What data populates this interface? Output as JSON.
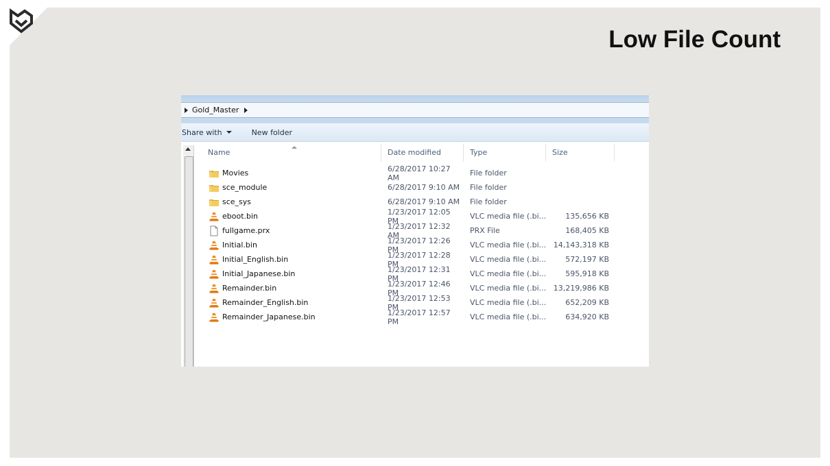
{
  "slide": {
    "title": "Low File Count"
  },
  "explorer": {
    "breadcrumb": [
      "Gold_Master"
    ],
    "toolbar": {
      "share_with": "Share with",
      "new_folder": "New folder"
    },
    "columns": {
      "name": "Name",
      "date": "Date modified",
      "type": "Type",
      "size": "Size"
    },
    "files": [
      {
        "name": "Movies",
        "date": "6/28/2017 10:27 AM",
        "type": "File folder",
        "size": "",
        "icon": "folder-icon"
      },
      {
        "name": "sce_module",
        "date": "6/28/2017 9:10 AM",
        "type": "File folder",
        "size": "",
        "icon": "folder-icon"
      },
      {
        "name": "sce_sys",
        "date": "6/28/2017 9:10 AM",
        "type": "File folder",
        "size": "",
        "icon": "folder-icon"
      },
      {
        "name": "eboot.bin",
        "date": "1/23/2017 12:05 PM",
        "type": "VLC media file (.bi...",
        "size": "135,656 KB",
        "icon": "vlc-cone-icon"
      },
      {
        "name": "fullgame.prx",
        "date": "1/23/2017 12:32 AM",
        "type": "PRX File",
        "size": "168,405 KB",
        "icon": "blank-file-icon"
      },
      {
        "name": "Initial.bin",
        "date": "1/23/2017 12:26 PM",
        "type": "VLC media file (.bi...",
        "size": "14,143,318 KB",
        "icon": "vlc-cone-icon"
      },
      {
        "name": "Initial_English.bin",
        "date": "1/23/2017 12:28 PM",
        "type": "VLC media file (.bi...",
        "size": "572,197 KB",
        "icon": "vlc-cone-icon"
      },
      {
        "name": "Initial_Japanese.bin",
        "date": "1/23/2017 12:31 PM",
        "type": "VLC media file (.bi...",
        "size": "595,918 KB",
        "icon": "vlc-cone-icon"
      },
      {
        "name": "Remainder.bin",
        "date": "1/23/2017 12:46 PM",
        "type": "VLC media file (.bi...",
        "size": "13,219,986 KB",
        "icon": "vlc-cone-icon"
      },
      {
        "name": "Remainder_English.bin",
        "date": "1/23/2017 12:53 PM",
        "type": "VLC media file (.bi...",
        "size": "652,209 KB",
        "icon": "vlc-cone-icon"
      },
      {
        "name": "Remainder_Japanese.bin",
        "date": "1/23/2017 12:57 PM",
        "type": "VLC media file (.bi...",
        "size": "634,920 KB",
        "icon": "vlc-cone-icon"
      }
    ]
  },
  "colors": {
    "slide_bg": "#e8e6e2",
    "title": "#111111",
    "folder": "#e8b84a",
    "vlc_orange": "#f08a1c",
    "explorer_blue": "#c6daef"
  }
}
